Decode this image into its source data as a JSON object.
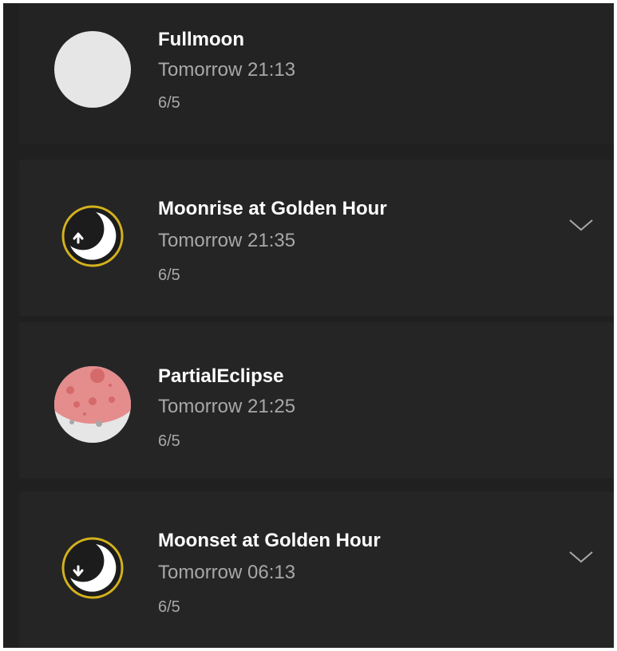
{
  "events": [
    {
      "title": "Fullmoon",
      "time": "Tomorrow 21:13",
      "date": "6/5",
      "icon": "full-moon-icon",
      "expandable": false
    },
    {
      "title": "Moonrise at Golden Hour",
      "time": "Tomorrow 21:35",
      "date": "6/5",
      "icon": "moonrise-icon",
      "expandable": true
    },
    {
      "title": "PartialEclipse",
      "time": "Tomorrow 21:25",
      "date": "6/5",
      "icon": "partial-eclipse-icon",
      "expandable": false
    },
    {
      "title": "Moonset at Golden Hour",
      "time": "Tomorrow 06:13",
      "date": "6/5",
      "icon": "moonset-icon",
      "expandable": true
    }
  ],
  "colors": {
    "background": "#202020",
    "card": "#252525",
    "title_text": "#ffffff",
    "secondary_text": "#a8a8a8",
    "moon_white": "#e6e6e6",
    "ring_gold": "#d4b21c",
    "eclipse_red": "#e58c8c"
  }
}
